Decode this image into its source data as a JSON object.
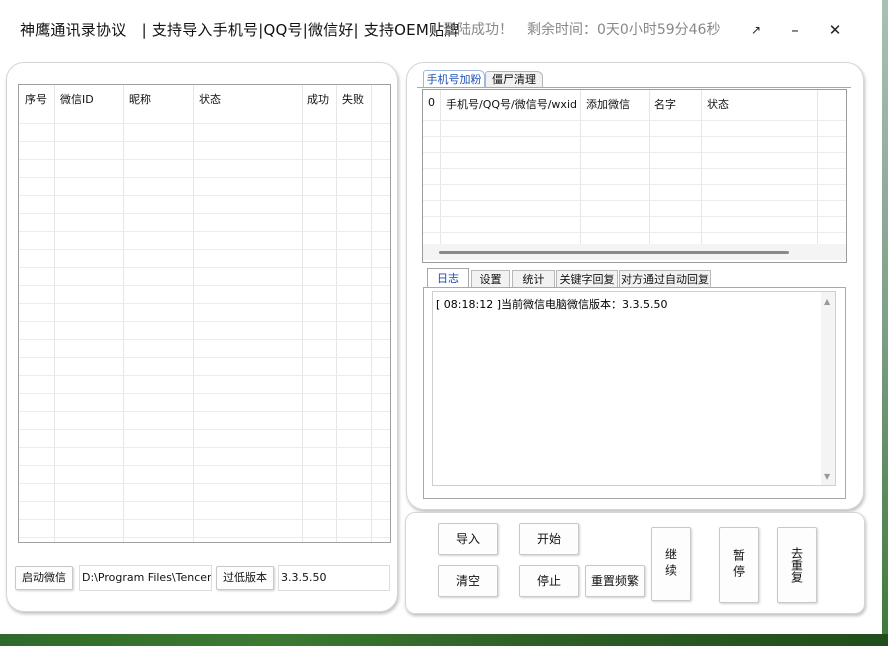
{
  "title": {
    "app": "神鹰通讯录协议　| 支持导入手机号|QQ号|微信好| 支持OEM贴牌",
    "status": "登陆成功！　剩余时间：0天0小时59分46秒"
  },
  "window_controls": {
    "restore": "↗",
    "minimize": "–",
    "close": "✕"
  },
  "left_table": {
    "headers": [
      "序号",
      "微信ID",
      "昵称",
      "状态",
      "成功",
      "失败"
    ]
  },
  "left_bottom": {
    "start_wechat": "启动微信",
    "path_value": "D:\\Program Files\\Tencent",
    "low_version_button": "过低版本",
    "version_value": "3.3.5.50"
  },
  "top_tabs": [
    "手机号加粉",
    "僵尸清理"
  ],
  "right_table": {
    "headers": [
      "0",
      "手机号/QQ号/微信号/wxid",
      "添加微信",
      "名字",
      "状态"
    ]
  },
  "bottom_tabs": [
    "日志",
    "设置",
    "统计",
    "关键字回复",
    "对方通过自动回复"
  ],
  "log": {
    "lines": [
      "[ 08:18:12 ]当前微信电脑微信版本：3.3.5.50"
    ]
  },
  "actions": {
    "import": "导入",
    "start": "开始",
    "clear": "清空",
    "stop": "停止",
    "reset_freq": "重置频繁",
    "continue": "继续",
    "pause": "暂停",
    "dedupe": "去重复"
  }
}
